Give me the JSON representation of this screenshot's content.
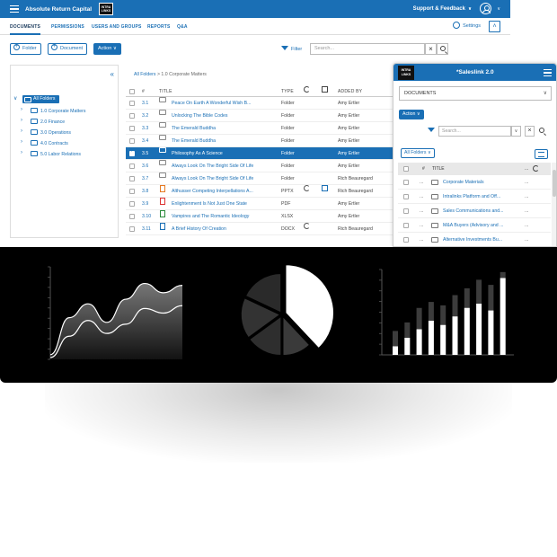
{
  "header": {
    "app_title": "Absolute Return Capital",
    "logo_line1": "INTRA",
    "logo_line2": "LINKS",
    "support_label": "Support & Feedback"
  },
  "nav": {
    "tabs": [
      {
        "label": "DOCUMENTS",
        "active": true
      },
      {
        "label": "PERMISSIONS"
      },
      {
        "label": "USERS AND GROUPS"
      },
      {
        "label": "REPORTS"
      },
      {
        "label": "Q&A"
      }
    ],
    "settings_label": "Settings"
  },
  "toolbar": {
    "folder_label": "Folder",
    "document_label": "Document",
    "action_label": "Action",
    "filter_label": "Filter",
    "search_placeholder": "Search..."
  },
  "tree": {
    "root": "All Folders",
    "items": [
      "1.0 Corporate Matters",
      "2.0 Finance",
      "3.0 Operations",
      "4.0 Contracts",
      "5.0 Labor Relations"
    ]
  },
  "grid": {
    "breadcrumb_link": "All Folders",
    "breadcrumb_rest": " > 1.0 Corporate Matters",
    "col_num": "#",
    "col_title": "TITLE",
    "col_type": "TYPE",
    "col_added": "ADDED BY",
    "rows": [
      {
        "num": "3.1",
        "title": "Peace On Earth A Wonderful Wish B...",
        "type": "Folder",
        "added": "Amy Ertler",
        "icon": "folder"
      },
      {
        "num": "3.2",
        "title": "Unlocking The Bible Codes",
        "type": "Folder",
        "added": "Amy Ertler",
        "icon": "folder"
      },
      {
        "num": "3.3",
        "title": "The Emerald Buddha",
        "type": "Folder",
        "added": "Amy Ertler",
        "icon": "folder"
      },
      {
        "num": "3.4",
        "title": "The Emerald Buddha",
        "type": "Folder",
        "added": "Amy Ertler",
        "icon": "folder"
      },
      {
        "num": "3.5",
        "title": "Philosophy As A Science",
        "type": "Folder",
        "added": "Amy Ertler",
        "icon": "folder",
        "selected": true
      },
      {
        "num": "3.6",
        "title": "Always Look On The Bright Side Of Life",
        "type": "Folder",
        "added": "Amy Ertler",
        "icon": "folder"
      },
      {
        "num": "3.7",
        "title": "Always Look On The Bright Side Of Life",
        "type": "Folder",
        "added": "Rich Beauregard",
        "icon": "folder"
      },
      {
        "num": "3.8",
        "title": "Althusser Competing Interpellations A...",
        "type": "PPTX",
        "added": "Rich Beauregard",
        "icon": "pptx",
        "sync": true,
        "edit": true
      },
      {
        "num": "3.9",
        "title": "Enlightenment Is Not Just One State",
        "type": "PDF",
        "added": "Amy Ertler",
        "icon": "pdf"
      },
      {
        "num": "3.10",
        "title": "Vampires and The Romantic Ideology",
        "type": "XLSX",
        "added": "Amy Ertler",
        "icon": "xlsx"
      },
      {
        "num": "3.11",
        "title": "A Brief History Of Creation",
        "type": "DOCX",
        "added": "Rich Beauregard",
        "icon": "docx",
        "sync": true
      }
    ]
  },
  "side": {
    "logo_line1": "INTRA",
    "logo_line2": "LINKS",
    "title": "*Saleslink 2.0",
    "dropdown_value": "DOCUMENTS",
    "action_label": "Action",
    "search_placeholder": "Search...",
    "all_folders_label": "All Folders",
    "col_num": "#",
    "col_title": "TITLE",
    "col_dots": "...",
    "rows": [
      {
        "dots": "...",
        "title": "Corporate Materials",
        "more": "..."
      },
      {
        "dots": "...",
        "title": "Intralinks Platform and Off...",
        "more": "..."
      },
      {
        "dots": "...",
        "title": "Sales Communications and...",
        "more": "..."
      },
      {
        "dots": "...",
        "title": "M&A Buyers (Advisory and ...",
        "more": "..."
      },
      {
        "dots": "...",
        "title": "Alternative Investments Bu...",
        "more": "..."
      }
    ]
  },
  "colors": {
    "brand": "#1a6fb5",
    "dark_band": "#000000"
  },
  "chart_data": [
    {
      "type": "area",
      "x": [
        0,
        1,
        2,
        3,
        4,
        5,
        6,
        7
      ],
      "series": [
        {
          "values": [
            0.05,
            0.45,
            0.6,
            0.4,
            0.65,
            0.82,
            0.72,
            0.8
          ]
        },
        {
          "values": [
            0.02,
            0.25,
            0.42,
            0.28,
            0.38,
            0.55,
            0.5,
            0.58
          ]
        }
      ]
    },
    {
      "type": "pie",
      "values": [
        38,
        12,
        15,
        17,
        18
      ]
    },
    {
      "type": "bar",
      "categories": [
        "1",
        "2",
        "3",
        "4",
        "5",
        "6",
        "7",
        "8",
        "9",
        "10"
      ],
      "series": [
        {
          "values": [
            0.1,
            0.2,
            0.3,
            0.4,
            0.35,
            0.45,
            0.55,
            0.6,
            0.52,
            0.9
          ]
        },
        {
          "values": [
            0.28,
            0.38,
            0.55,
            0.62,
            0.58,
            0.7,
            0.78,
            0.88,
            0.82,
            0.97
          ]
        }
      ]
    }
  ]
}
